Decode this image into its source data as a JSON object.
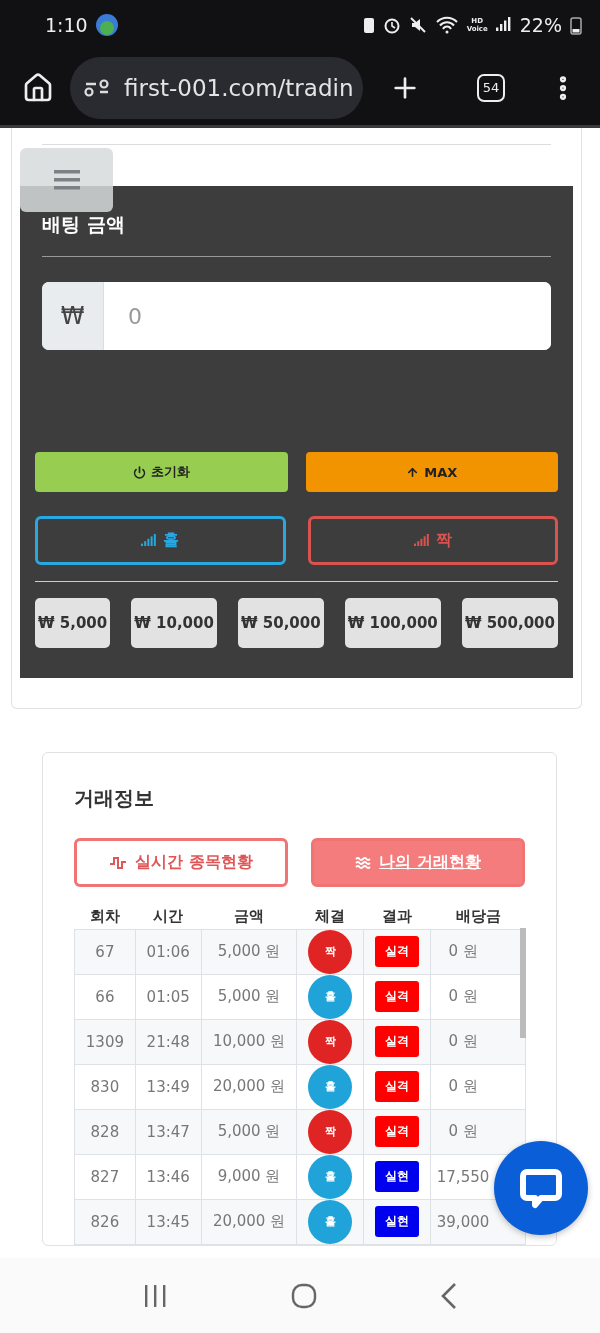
{
  "status_bar": {
    "time": "1:10",
    "network_badge": [
      "HD",
      "Voice"
    ],
    "battery": "22%"
  },
  "browser": {
    "url": "first-001.com/tradin",
    "tab_count": "54"
  },
  "bet_panel": {
    "title": "배팅 금액",
    "currency": "₩",
    "amount_placeholder": "0",
    "actions": [
      {
        "kind": "reset",
        "label": "초기화"
      },
      {
        "kind": "max",
        "label": "MAX"
      }
    ],
    "picks": [
      {
        "kind": "odd",
        "label": "홀"
      },
      {
        "kind": "even",
        "label": "짝"
      }
    ],
    "chips": [
      "₩ 5,000",
      "₩ 10,000",
      "₩ 50,000",
      "₩ 100,000",
      "₩ 500,000"
    ]
  },
  "trade_info": {
    "title": "거래정보",
    "tabs": [
      {
        "kind": "live",
        "label": "실시간 종목현황",
        "selected": false
      },
      {
        "kind": "mine",
        "label": "나의 거래현황",
        "selected": true
      }
    ],
    "columns": [
      "회차",
      "시간",
      "금액",
      "체결",
      "결과",
      "배당금"
    ],
    "rows": [
      {
        "round": "67",
        "time": "01:06",
        "amount": "5,000 원",
        "side": {
          "kind": "even",
          "label": "짝"
        },
        "result": {
          "kind": "lose",
          "label": "실격"
        },
        "payout": "0 원"
      },
      {
        "round": "66",
        "time": "01:05",
        "amount": "5,000 원",
        "side": {
          "kind": "odd",
          "label": "홀"
        },
        "result": {
          "kind": "lose",
          "label": "실격"
        },
        "payout": "0 원"
      },
      {
        "round": "1309",
        "time": "21:48",
        "amount": "10,000 원",
        "side": {
          "kind": "even",
          "label": "짝"
        },
        "result": {
          "kind": "lose",
          "label": "실격"
        },
        "payout": "0 원"
      },
      {
        "round": "830",
        "time": "13:49",
        "amount": "20,000 원",
        "side": {
          "kind": "odd",
          "label": "홀"
        },
        "result": {
          "kind": "lose",
          "label": "실격"
        },
        "payout": "0 원"
      },
      {
        "round": "828",
        "time": "13:47",
        "amount": "5,000 원",
        "side": {
          "kind": "even",
          "label": "짝"
        },
        "result": {
          "kind": "lose",
          "label": "실격"
        },
        "payout": "0 원"
      },
      {
        "round": "827",
        "time": "13:46",
        "amount": "9,000 원",
        "side": {
          "kind": "odd",
          "label": "홀"
        },
        "result": {
          "kind": "win",
          "label": "실현"
        },
        "payout": "17,550"
      },
      {
        "round": "826",
        "time": "13:45",
        "amount": "20,000 원",
        "side": {
          "kind": "odd",
          "label": "홀"
        },
        "result": {
          "kind": "win",
          "label": "실현"
        },
        "payout": "39,000"
      }
    ]
  }
}
